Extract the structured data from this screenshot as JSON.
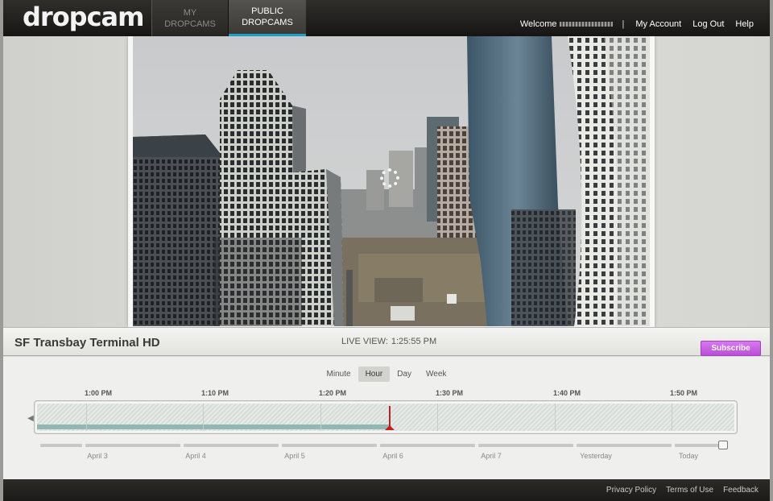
{
  "header": {
    "logo": "dropcam",
    "tabs": [
      {
        "line1": "MY",
        "line2": "DROPCAMS"
      },
      {
        "line1": "PUBLIC",
        "line2": "DROPCAMS"
      }
    ],
    "welcome": "Welcome",
    "separator": "|",
    "links": [
      "My Account",
      "Log Out",
      "Help"
    ]
  },
  "camera": {
    "title": "SF Transbay Terminal HD",
    "live_label": "LIVE VIEW:",
    "live_time": "1:25:55 PM",
    "subscribe_label": "Subscribe"
  },
  "timeline": {
    "zoom_options": [
      "Minute",
      "Hour",
      "Day",
      "Week"
    ],
    "zoom_selected": "Hour",
    "time_labels": [
      "1:00 PM",
      "1:10 PM",
      "1:20 PM",
      "1:30 PM",
      "1:40 PM",
      "1:50 PM"
    ],
    "day_labels": [
      "April 3",
      "April 4",
      "April 5",
      "April 6",
      "April 7",
      "Yesterday",
      "Today"
    ]
  },
  "footer": {
    "links": [
      "Privacy Policy",
      "Terms of Use",
      "Feedback"
    ]
  },
  "colors": {
    "accent": "#27a7d8",
    "subscribe": "#c25fe0",
    "playhead": "#c41d1d",
    "recorded": "#93b7b5"
  },
  "icons": {
    "spinner": "loading-spinner-icon",
    "ruler_left": "triangle-left-icon"
  }
}
